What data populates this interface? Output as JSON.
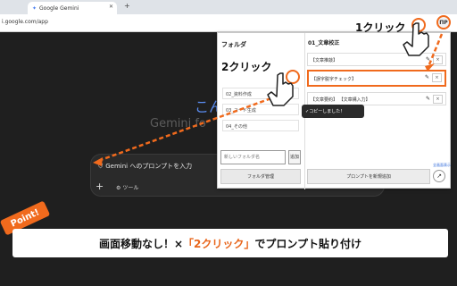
{
  "browser": {
    "tab_title": "Google Gemini",
    "tab_close": "✕",
    "new_tab": "+",
    "url": "i.google.com/app",
    "ext_label": "ΠΡ"
  },
  "gemini": {
    "hello": "こん",
    "sub": "Gemini fo",
    "prompt_placeholder": "Gemini へのプロンプトを入力",
    "tools_label": "ツール"
  },
  "panel": {
    "folder_title": "フォルダ",
    "folders": [
      {
        "label": "02_資料作成"
      },
      {
        "label": "03_コード生成"
      },
      {
        "label": "04_その他"
      }
    ],
    "new_folder_placeholder": "新しいフォルダ名",
    "add_label": "追加",
    "folder_manage": "フォルダ管理",
    "category_title": "01_文章校正",
    "prompts": [
      {
        "label": "【文章推敲】"
      },
      {
        "label": "【誤字脱字チェック】"
      },
      {
        "label": "【文章要約】 【文章構入力】"
      }
    ],
    "copy_toast": "✓コピーしました！",
    "fullscreen": "全画面表示",
    "new_prompt": "プロンプトを新規追加"
  },
  "annotations": {
    "click1": "1クリック",
    "click2": "2クリック",
    "point": "Point!",
    "banner_a": "画面移動なし！×",
    "banner_b": "「2クリック」",
    "banner_c": "でプロンプト貼り付け"
  },
  "colors": {
    "accent": "#f06a1d"
  }
}
